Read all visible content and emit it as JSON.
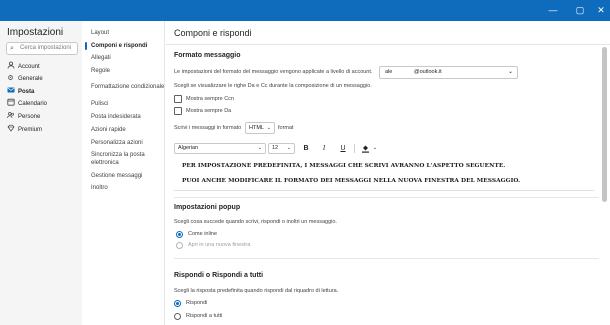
{
  "window": {
    "controls": [
      "—",
      "▢",
      "✕"
    ]
  },
  "settings_nav": {
    "title": "Impostazioni",
    "search_placeholder": "Cerca impostazioni",
    "items": [
      {
        "label": "Account",
        "icon": "person-icon"
      },
      {
        "label": "Generale",
        "icon": "gear-icon"
      },
      {
        "label": "Posta",
        "icon": "mail-icon",
        "active": true
      },
      {
        "label": "Calendario",
        "icon": "calendar-icon"
      },
      {
        "label": "Persone",
        "icon": "people-icon"
      },
      {
        "label": "Premium",
        "icon": "diamond-icon"
      }
    ]
  },
  "mail_nav": {
    "items": [
      {
        "label": "Layout"
      },
      {
        "label": "Componi e rispondi",
        "active": true
      },
      {
        "label": "Allegati"
      },
      {
        "label": "Regole"
      },
      {
        "label": "Formattazione condizionale"
      },
      {
        "label": "Pulisci"
      },
      {
        "label": "Posta indesiderata"
      },
      {
        "label": "Azioni rapide"
      },
      {
        "label": "Personalizza azioni"
      },
      {
        "label": "Sincronizza la posta elettronica"
      },
      {
        "label": "Gestione messaggi"
      },
      {
        "label": "Inoltro"
      }
    ]
  },
  "main": {
    "title": "Componi e rispondi",
    "formato": {
      "title": "Formato messaggio",
      "desc": "Le impostazioni del formato del messaggio vengono applicate a livello di account.",
      "account_user": "ale",
      "account_domain": "@outlook.it",
      "chevron": "⌄",
      "from_to_desc": "Scegli se visualizzare le righe Da e Cc durante la composizione di un messaggio.",
      "show_cc": "Mostra sempre Ccn",
      "show_from": "Mostra sempre Da",
      "compose_prefix": "Scrivi i messaggi in formato",
      "compose_format": "HTML",
      "compose_suffix": "format",
      "font_name": "Algerian",
      "font_size": "12",
      "bold": "B",
      "italic": "I",
      "underline": "U",
      "more": "⌄",
      "preview_line1": "PER IMPOSTAZIONE PREDEFINITA, I MESSAGGI CHE SCRIVI AVRANNO L'ASPETTO SEGUENTE.",
      "preview_line2": "PUOI ANCHE MODIFICARE IL FORMATO DEI MESSAGGI NELLA NUOVA FINESTRA DEL MESSAGGIO."
    },
    "popup": {
      "title": "Impostazioni popup",
      "desc": "Scegli cosa succede quando scrivi, rispondi o inoltri un messaggio.",
      "option1": "Come inline",
      "option2": "Apri in una nuova finestra"
    },
    "reply": {
      "title": "Rispondi o Rispondi a tutti",
      "desc": "Scegli la risposta predefinita quando rispondi dal riquadro di lettura.",
      "option1": "Rispondi",
      "option2": "Rispondi a tutti"
    }
  },
  "colors": {
    "accent": "#0f6cbd",
    "titlebar": "#0f6cbd",
    "nav_bg": "#f5f5f5"
  }
}
